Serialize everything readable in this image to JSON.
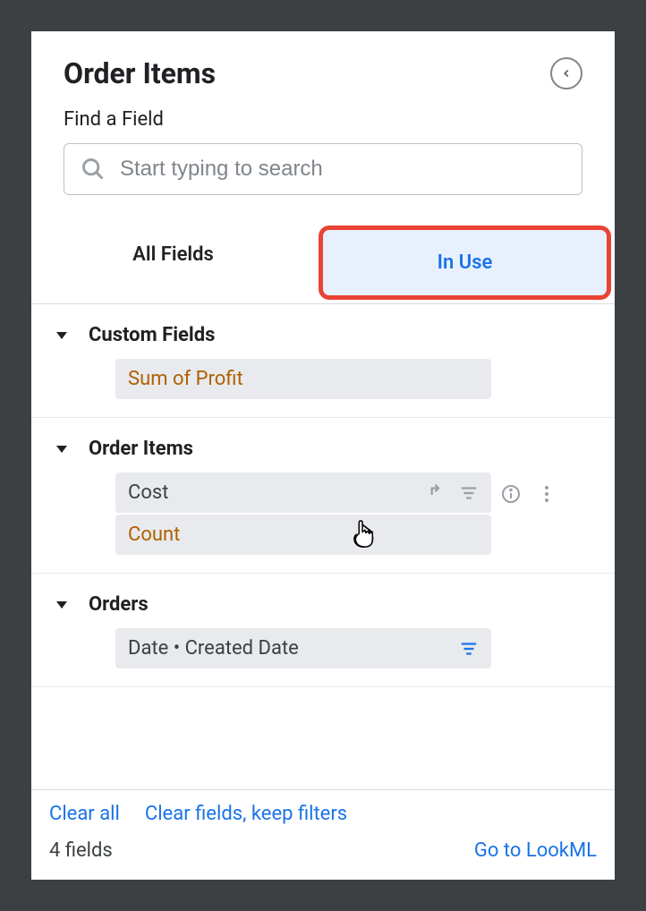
{
  "header": {
    "title": "Order Items"
  },
  "search": {
    "label": "Find a Field",
    "placeholder": "Start typing to search"
  },
  "tabs": {
    "all": "All Fields",
    "in_use": "In Use"
  },
  "groups": [
    {
      "title": "Custom Fields",
      "fields": [
        {
          "label": "Sum of Profit",
          "is_measure": true,
          "hovered": false,
          "filtered": false
        }
      ]
    },
    {
      "title": "Order Items",
      "fields": [
        {
          "label": "Cost",
          "is_measure": false,
          "hovered": true,
          "filtered": false
        },
        {
          "label": "Count",
          "is_measure": true,
          "hovered": false,
          "filtered": false
        }
      ]
    },
    {
      "title": "Orders",
      "fields": [
        {
          "label": "Date • Created Date",
          "is_measure": false,
          "hovered": false,
          "filtered": true
        }
      ]
    }
  ],
  "bottom": {
    "clear_all": "Clear all",
    "clear_fields": "Clear fields, keep filters"
  },
  "footer": {
    "count_label": "4 fields",
    "lookml": "Go to LookML"
  }
}
